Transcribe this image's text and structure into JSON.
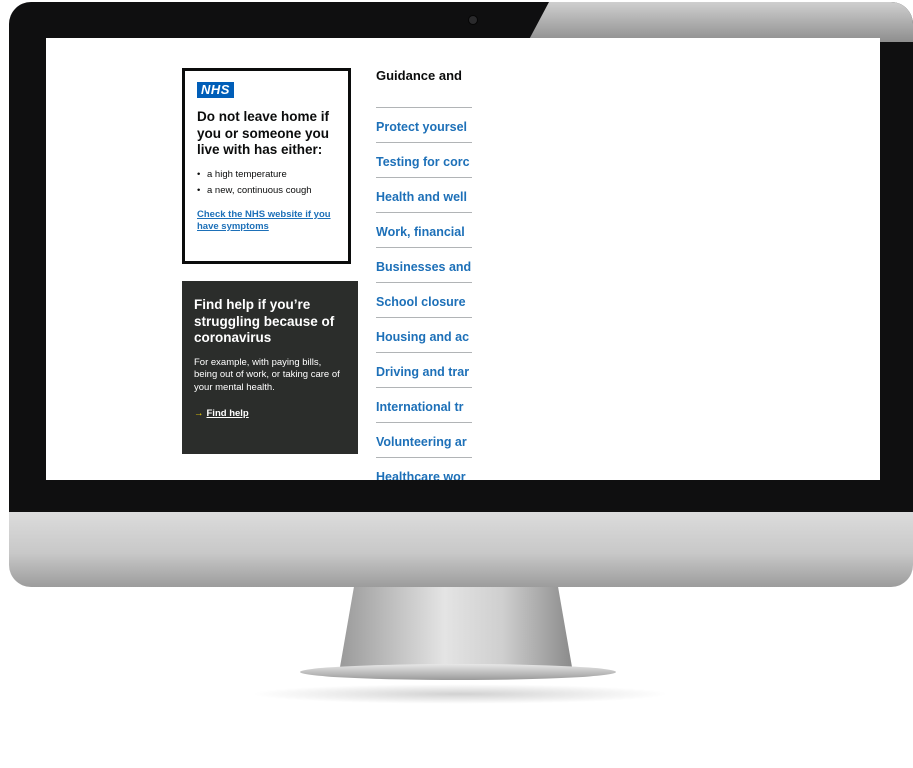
{
  "nhs_box": {
    "logo": "NHS",
    "heading": "Do not leave home if you or someone you live with has either:",
    "symptoms": [
      "a high temperature",
      "a new, continuous cough"
    ],
    "link": "Check the NHS website if you have symptoms"
  },
  "help_box": {
    "heading": "Find help if you’re struggling because of coronavirus",
    "text": "For example, with paying bills, being out of work, or taking care of your mental health.",
    "link": "Find help"
  },
  "guidance": {
    "title": "Guidance and",
    "items": [
      "Protect yoursel",
      "Testing for corc",
      "Health and well",
      "Work, financial",
      "Businesses and",
      "School closure",
      "Housing and ac",
      "Driving and trar",
      "International tr",
      "Volunteering ar",
      "Healthcare wor"
    ]
  },
  "colors": {
    "link": "#1d70b8",
    "nhs_blue": "#005eb8",
    "help_bg": "#2b2d2b",
    "arrow": "#ffdd00"
  }
}
